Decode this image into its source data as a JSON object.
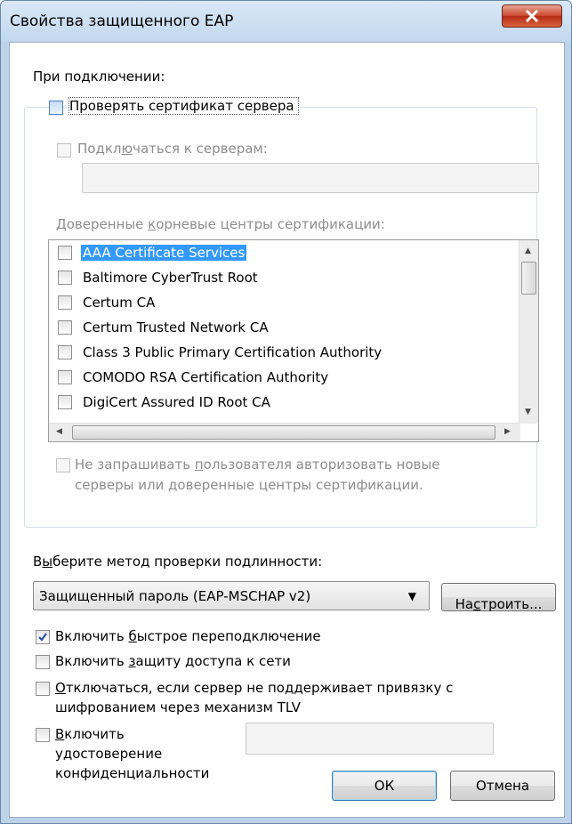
{
  "window": {
    "title": "Свойства защищенного EAP"
  },
  "connect_label": "При подключении:",
  "verify_cert": {
    "label": "Проверять сертификат сервера",
    "checked": false
  },
  "connect_servers": {
    "label_pre": "Подкл",
    "label_u": "ю",
    "label_post": "чаться к серверам:",
    "checked": false,
    "value": ""
  },
  "trusted_roots": {
    "label_pre": "Доверенные ",
    "label_u": "к",
    "label_post": "орневые центры сертификации:",
    "items": [
      {
        "label": "AAA Certificate Services",
        "checked": false,
        "selected": true
      },
      {
        "label": "Baltimore CyberTrust Root",
        "checked": false,
        "selected": false
      },
      {
        "label": "Certum CA",
        "checked": false,
        "selected": false
      },
      {
        "label": "Certum Trusted Network CA",
        "checked": false,
        "selected": false
      },
      {
        "label": "Class 3 Public Primary Certification Authority",
        "checked": false,
        "selected": false
      },
      {
        "label": "COMODO RSA Certification Authority",
        "checked": false,
        "selected": false
      },
      {
        "label": "DigiCert Assured ID Root CA",
        "checked": false,
        "selected": false
      }
    ]
  },
  "no_prompt": {
    "label_line1_pre": "Не запрашивать ",
    "label_line1_u": "п",
    "label_line1_post": "ользователя авторизовать новые",
    "label_line2": "серверы или доверенные центры сертификации.",
    "checked": false
  },
  "auth_method": {
    "label_pre": "В",
    "label_u": "ы",
    "label_post": "берите метод проверки подлинности:",
    "selected": "Защищенный пароль (EAP-MSCHAP v2)",
    "configure_pre": "На",
    "configure_u": "с",
    "configure_post": "троить..."
  },
  "options": {
    "fast_reconnect": {
      "pre": "Включить ",
      "u": "б",
      "post": "ыстрое переподключение",
      "checked": true
    },
    "nap": {
      "pre": "Включить ",
      "u": "з",
      "post": "ащиту доступа к сети",
      "checked": false
    },
    "disconnect_tlv": {
      "u": "О",
      "line1_post": "тключаться, если сервер не поддерживает привязку с",
      "line2": "шифрованием через механизм TLV",
      "checked": false
    },
    "identity_privacy": {
      "u": "В",
      "line1_post": "ключить",
      "line2": "удостоверение",
      "line3": "конфиденциальности",
      "checked": false,
      "value": ""
    }
  },
  "buttons": {
    "ok": "ОК",
    "cancel": "Отмена"
  }
}
